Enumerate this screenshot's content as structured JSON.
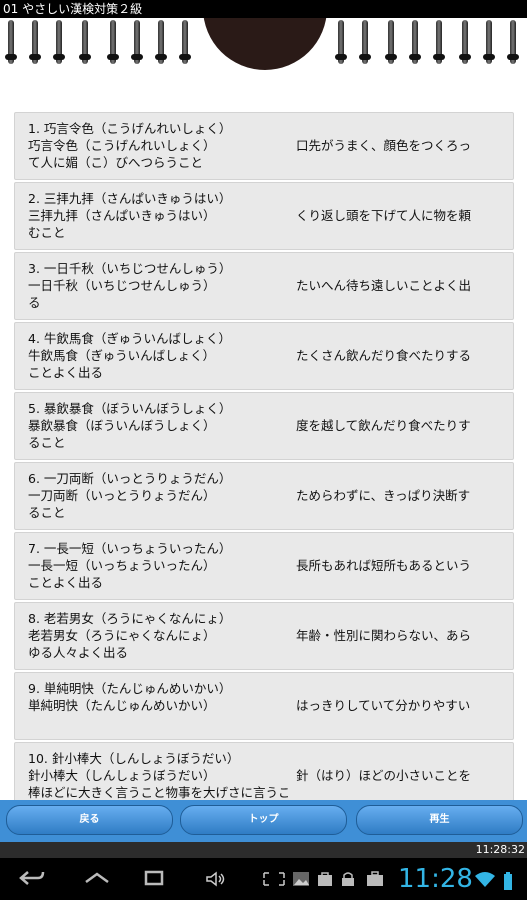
{
  "app": {
    "title": "01 やさしい漢検対策２級"
  },
  "items": [
    {
      "left": [
        "1. 巧言令色（こうげんれいしょく）",
        "巧言令色（こうげんれいしょく）",
        "て人に媚（こ）びへつらうこと"
      ],
      "right": "口先がうまく、顔色をつくろっ"
    },
    {
      "left": [
        "2. 三拝九拝（さんぱいきゅうはい）",
        "三拝九拝（さんぱいきゅうはい）",
        "むこと"
      ],
      "right": "くり返し頭を下げて人に物を頼"
    },
    {
      "left": [
        "3. 一日千秋（いちじつせんしゅう）",
        "一日千秋（いちじつせんしゅう）",
        "る"
      ],
      "right": "たいへん待ち遠しいことよく出"
    },
    {
      "left": [
        "4. 牛飲馬食（ぎゅういんばしょく）",
        "牛飲馬食（ぎゅういんばしょく）",
        "ことよく出る"
      ],
      "right": "たくさん飲んだり食べたりする"
    },
    {
      "left": [
        "5. 暴飲暴食（ぼういんぼうしょく）",
        "暴飲暴食（ぼういんぼうしょく）",
        "ること"
      ],
      "right": "度を越して飲んだり食べたりす"
    },
    {
      "left": [
        "6. 一刀両断（いっとうりょうだん）",
        "一刀両断（いっとうりょうだん）",
        "ること"
      ],
      "right": "ためらわずに、きっぱり決断す"
    },
    {
      "left": [
        "7. 一長一短（いっちょういったん）",
        "一長一短（いっちょういったん）",
        "ことよく出る"
      ],
      "right": "長所もあれば短所もあるという"
    },
    {
      "left": [
        "8. 老若男女（ろうにゃくなんにょ）",
        "老若男女（ろうにゃくなんにょ）",
        "ゆる人々よく出る"
      ],
      "right": "年齢・性別に関わらない、あら"
    },
    {
      "left": [
        "9. 単純明快（たんじゅんめいかい）",
        "単純明快（たんじゅんめいかい）",
        ""
      ],
      "right": "はっきりしていて分かりやすい"
    },
    {
      "left": [
        "10. 針小棒大（しんしょうぼうだい）",
        "針小棒大（しんしょうぼうだい）",
        "棒ほどに大きく言うこと物事を大げさに言うことよく出る"
      ],
      "right": "針（はり）ほどの小さいことを"
    }
  ],
  "buttons": {
    "back": "戻る",
    "top": "トップ",
    "play": "再生"
  },
  "time_small": "11:28:32",
  "status": {
    "clock": "11:28"
  },
  "nav_icons": [
    "back-icon",
    "home-icon",
    "recent-apps-icon",
    "volume-icon",
    "screenshot-icon",
    "image-icon",
    "bag-icon",
    "lock-icon",
    "briefcase-icon",
    "wifi-icon",
    "battery-icon"
  ]
}
